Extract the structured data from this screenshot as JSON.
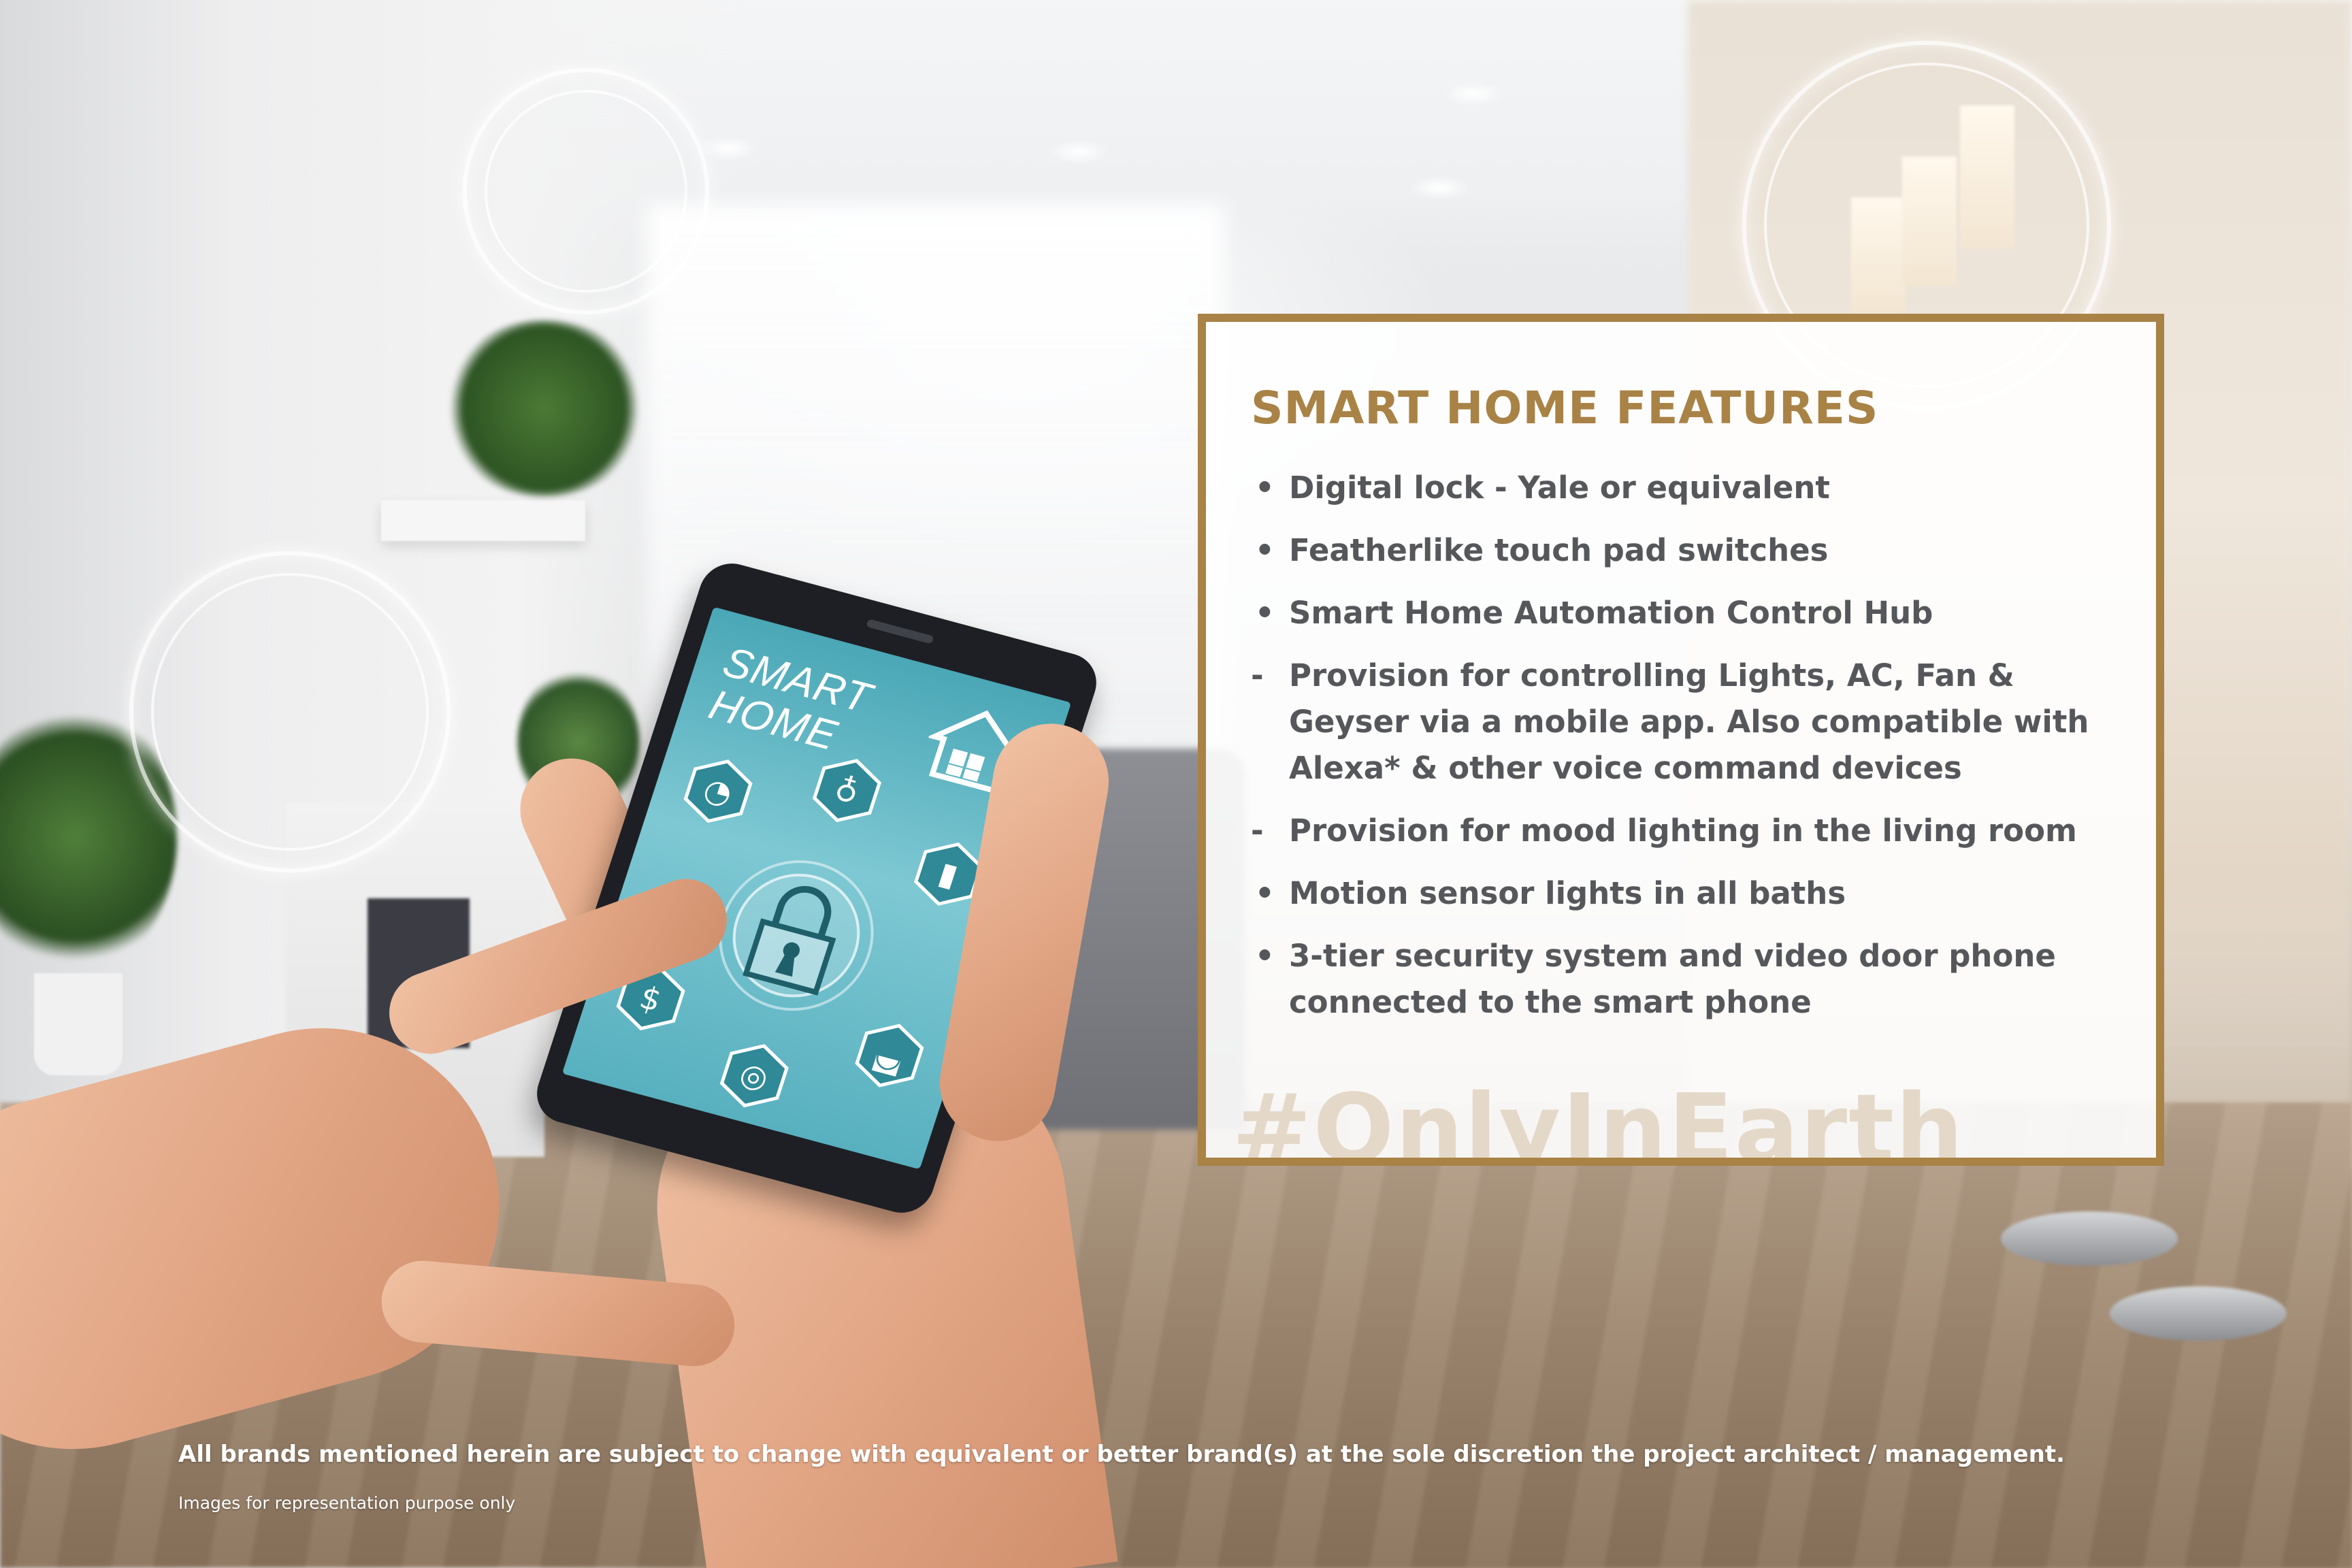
{
  "card": {
    "title": "SMART HOME FEATURES",
    "features": [
      {
        "marker": "•",
        "text": "Digital lock - Yale or equivalent"
      },
      {
        "marker": "•",
        "text": "Featherlike touch pad switches"
      },
      {
        "marker": "•",
        "text": "Smart Home Automation Control Hub"
      },
      {
        "marker": "-",
        "text": "Provision for controlling Lights, AC, Fan & Geyser via a mobile app. Also compatible with Alexa* & other voice command devices"
      },
      {
        "marker": "-",
        "text": "Provision for mood lighting in the living room"
      },
      {
        "marker": "•",
        "text": "Motion sensor lights in all baths"
      },
      {
        "marker": "•",
        "text": "3-tier security system and video door phone connected to the smart phone"
      }
    ],
    "hashtag": "#OnlyInEarth"
  },
  "phone": {
    "title_line1": "SMART",
    "title_line2": "HOME",
    "hex_icons": [
      "wifi-signal-icon",
      "light-bulb-icon",
      "thermometer-icon",
      "dollar-icon",
      "fingerprint-icon",
      "car-icon"
    ],
    "dollar_glyph": "$"
  },
  "footer": {
    "disclaimer": "All brands mentioned herein are subject to change with equivalent or better brand(s) at the sole discretion the project architect / management.",
    "note": "Images for representation purpose only"
  },
  "colors": {
    "accent": "#a98245",
    "feature_text": "#55575a",
    "hashtag": "#e4d9c9",
    "screen": "#6bbfcc"
  }
}
